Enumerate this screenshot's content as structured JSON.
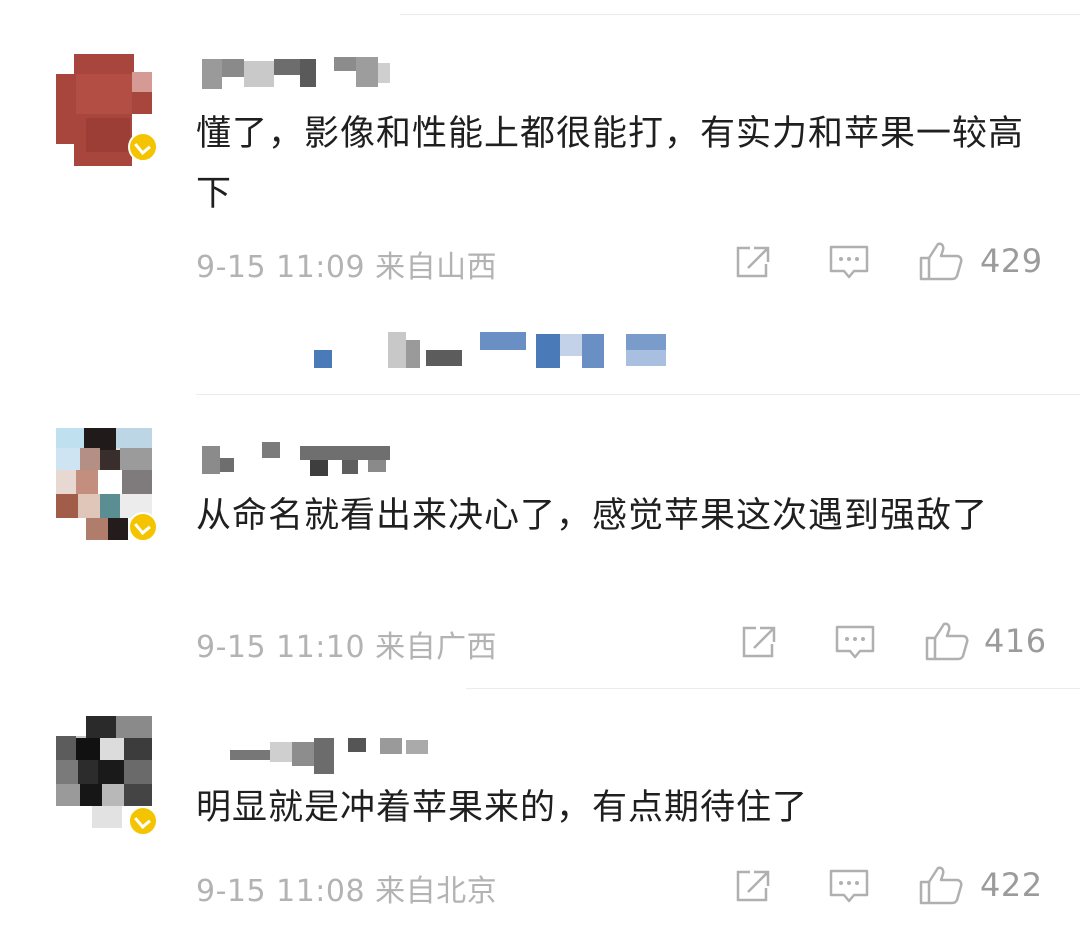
{
  "comments": [
    {
      "text": "懂了，影像和性能上都很能打，有实力和苹果一较高下",
      "time": "9-15 11:09",
      "location": "来自山西",
      "likes": "429",
      "icons": {
        "share": "share-icon",
        "reply": "comment-icon",
        "like": "thumbs-up-icon"
      }
    },
    {
      "text": "从命名就看出来决心了，感觉苹果这次遇到强敌了",
      "time": "9-15 11:10",
      "location": "来自广西",
      "likes": "416",
      "icons": {
        "share": "share-icon",
        "reply": "comment-icon",
        "like": "thumbs-up-icon"
      }
    },
    {
      "text": "明显就是冲着苹果来的，有点期待住了",
      "time": "9-15 11:08",
      "location": "来自北京",
      "likes": "422",
      "icons": {
        "share": "share-icon",
        "reply": "comment-icon",
        "like": "thumbs-up-icon"
      }
    }
  ],
  "colors": {
    "text": "#1f1f1f",
    "meta": "#b3b3b3",
    "icon": "#b0b0b0",
    "badge": "#f5c400",
    "divider": "#ececec",
    "link_blur": "#4a7ab8"
  }
}
